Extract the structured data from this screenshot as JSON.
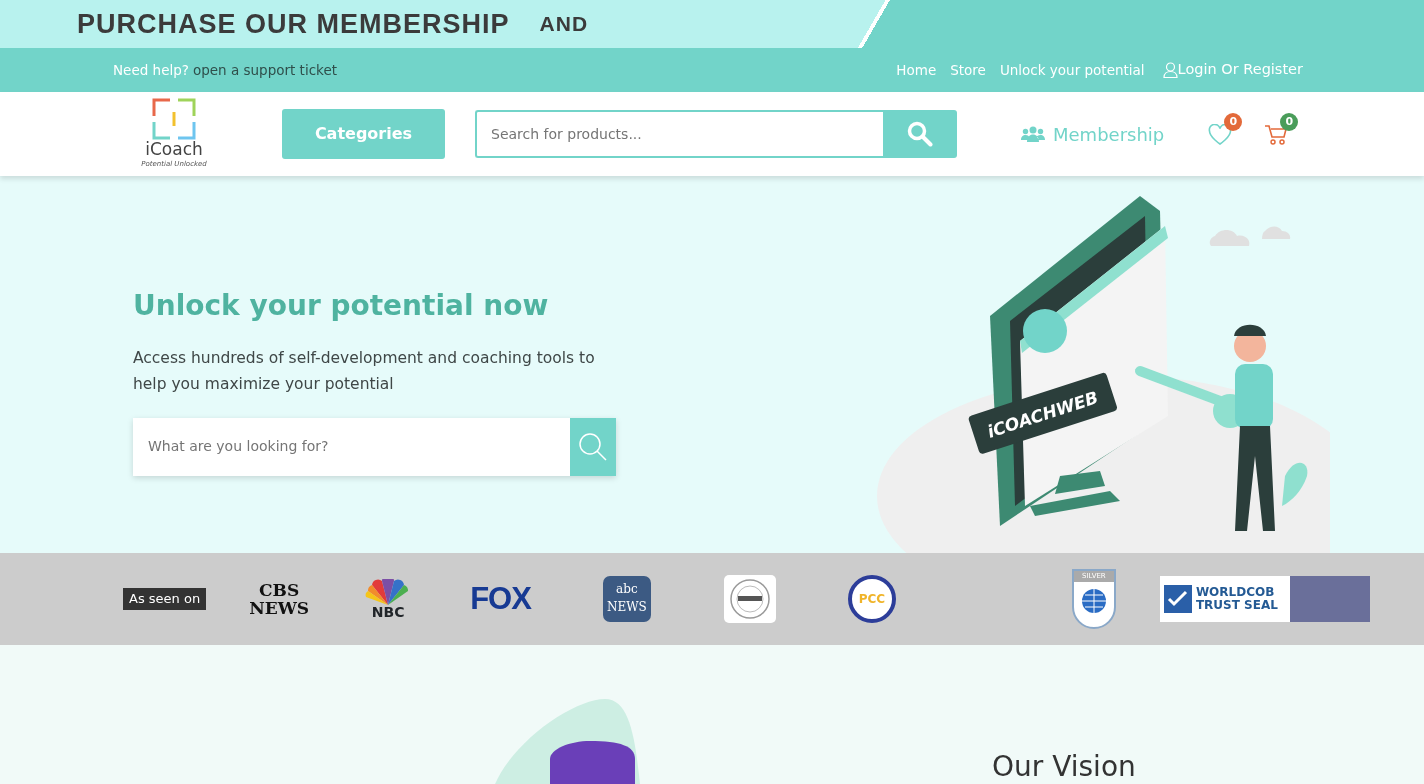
{
  "promo_banner": {
    "text": "PURCHASE OUR MEMBERSHIP",
    "text_2": "AND"
  },
  "top_bar": {
    "help_label": "Need help?",
    "help_link": "open a support ticket",
    "links": [
      "Home",
      "Store",
      "Unlock your potential"
    ],
    "login": "Login Or Register"
  },
  "header": {
    "logo_name": "iCoach",
    "logo_tagline": "Potential Unlocked",
    "categories_button": "Categories",
    "search": {
      "placeholder": "Search for products..."
    },
    "membership": "Membership",
    "wishlist_count": "0",
    "cart_count": "0"
  },
  "hero": {
    "title": "Unlock your potential now",
    "subtitle": "Access hundreds of self-development and coaching tools to help you maximize your potential",
    "search": {
      "placeholder": "What are you looking for?"
    },
    "illustration_text": "iCOACHWEB"
  },
  "press": {
    "label": "As seen on",
    "logos": [
      {
        "kind": "cbs",
        "text": "CBS NEWS"
      },
      {
        "kind": "nbc",
        "text": "NBC"
      },
      {
        "kind": "fox",
        "text": "FOX"
      },
      {
        "kind": "abc",
        "text": "abc NEWS"
      },
      {
        "kind": "iso"
      },
      {
        "kind": "pcc",
        "text": "PCC"
      },
      {
        "kind": "spacer"
      },
      {
        "kind": "shield",
        "text": "SILVER"
      },
      {
        "kind": "wts",
        "text": "WORLDCOB TRUST SEAL"
      }
    ]
  },
  "vision": {
    "title": "Our Vision"
  }
}
